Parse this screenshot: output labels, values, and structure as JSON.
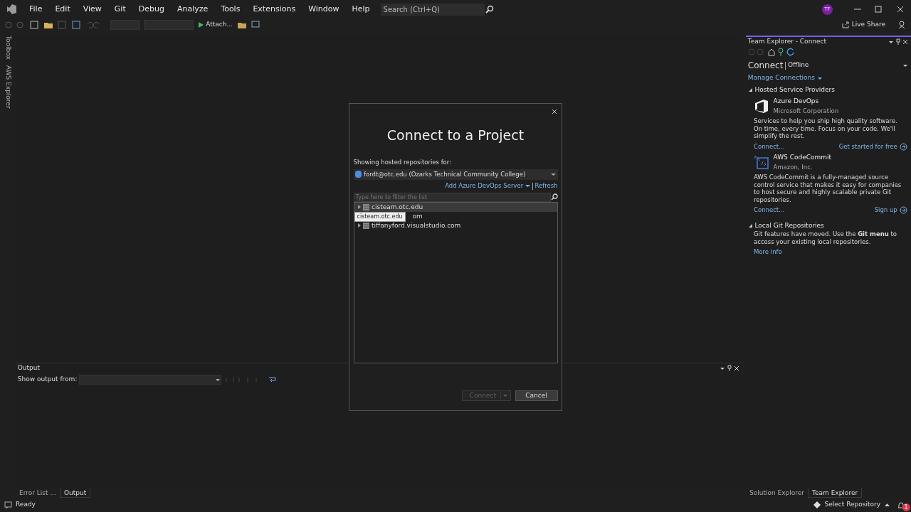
{
  "menu": {
    "items": [
      "File",
      "Edit",
      "View",
      "Git",
      "Debug",
      "Analyze",
      "Tools",
      "Extensions",
      "Window",
      "Help"
    ],
    "search_placeholder": "Search (Ctrl+Q)",
    "avatar": "TF"
  },
  "toolbar": {
    "attach": "Attach...",
    "live_share": "Live Share"
  },
  "side_tabs": [
    "Toolbox",
    "AWS Explorer"
  ],
  "team_explorer": {
    "title": "Team Explorer - Connect",
    "heading": "Connect",
    "status": "Offline",
    "manage": "Manage Connections",
    "sections": [
      {
        "title": "Hosted Service Providers",
        "expanded": true,
        "kind": "providers",
        "providers": [
          {
            "name": "Azure DevOps",
            "company": "Microsoft Corporation",
            "kind": "azure",
            "description": "Services to help you ship high quality software. On time, every time. Focus on your code. We'll simplify the rest.",
            "connect": "Connect...",
            "action": "Get started for free"
          },
          {
            "name": "AWS CodeCommit",
            "company": "Amazon, Inc.",
            "kind": "aws",
            "description": "AWS CodeCommit is a fully-managed source control service that makes it easy for companies to host secure and highly scalable private Git repositories.",
            "connect": "Connect...",
            "action": "Sign up"
          }
        ]
      },
      {
        "title": "Local Git Repositories",
        "expanded": true,
        "kind": "local",
        "text": "Git features have moved. Use the **Git menu** to access your existing local repositories.",
        "link": "More info"
      }
    ]
  },
  "output": {
    "title": "Output",
    "show_from": "Show output from:"
  },
  "bottom_tabs_left": [
    {
      "label": "Error List ...",
      "selected": false
    },
    {
      "label": "Output",
      "selected": true
    }
  ],
  "bottom_tabs_right": [
    {
      "label": "Solution Explorer",
      "selected": false
    },
    {
      "label": "Team Explorer",
      "selected": true
    }
  ],
  "status_bar": {
    "text": "Ready",
    "repository": "Select Repository",
    "notifications": "1"
  },
  "dialog": {
    "title": "Connect to a Project",
    "showing": "Showing hosted repositories for:",
    "account": "fordt@otc.edu (Ozarks Technical Community College)",
    "add_server": "Add Azure DevOps Server",
    "refresh": "Refresh",
    "filter_placeholder": "Type here to filter the list",
    "servers": [
      {
        "label": "cisteam.otc.edu",
        "selected": true,
        "kind": "full"
      },
      {
        "label": "om",
        "selected": false,
        "kind": "partial"
      },
      {
        "label": "tiffanyford.visualstudio.com",
        "selected": false,
        "kind": "full"
      }
    ],
    "tooltip": "cisteam.otc.edu",
    "buttons": [
      {
        "label": "Connect",
        "disabled": true,
        "kind": "split"
      },
      {
        "label": "Cancel",
        "disabled": false,
        "kind": "plain"
      }
    ]
  }
}
